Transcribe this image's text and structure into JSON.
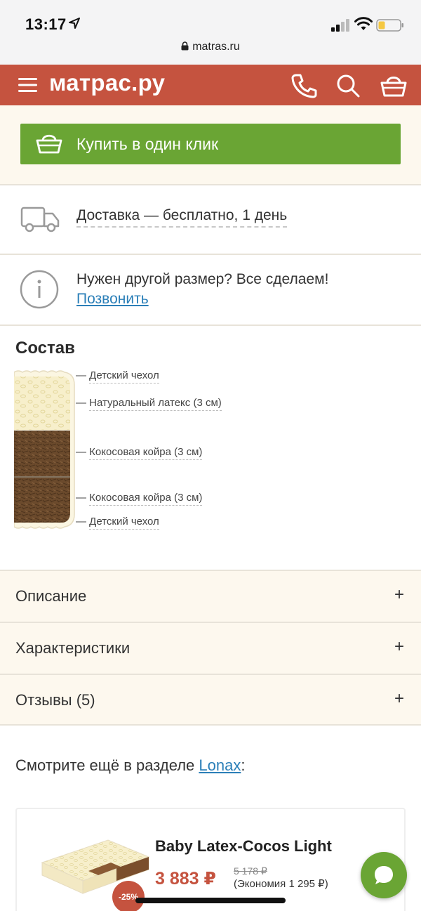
{
  "status_bar": {
    "time": "13:17"
  },
  "url_bar": {
    "url": "matras.ru"
  },
  "header": {
    "logo": "матрас.ру"
  },
  "buy": {
    "label": "Купить в один клик"
  },
  "delivery": {
    "text": "Доставка — бесплатно, 1 день"
  },
  "custom_size": {
    "text": "Нужен другой размер? Все сделаем!",
    "link": "Позвонить"
  },
  "composition": {
    "title": "Состав",
    "layers": [
      {
        "label": "Детский чехол"
      },
      {
        "label": "Натуральный латекс (3 см)"
      },
      {
        "label": "Кокосовая койра (3 см)"
      },
      {
        "label": "Кокосовая койра (3 см)"
      },
      {
        "label": "Детский чехол"
      }
    ]
  },
  "accordion": [
    {
      "label": "Описание",
      "icon": "+"
    },
    {
      "label": "Характеристики",
      "icon": "+"
    },
    {
      "label": "Отзывы (5)",
      "icon": "+"
    }
  ],
  "see_also": {
    "prefix": "Смотрите ещё в разделе ",
    "link": "Lonax",
    "suffix": ":"
  },
  "product": {
    "title": "Baby Latex-Cocos Light",
    "price": "3 883 ₽",
    "old_price": "5 178 ₽",
    "saving": "(Экономия 1 295 ₽)",
    "discount": "-25%"
  },
  "colors": {
    "brand_red": "#c5533f",
    "green": "#6aa534",
    "link_blue": "#2b7fb8",
    "cream": "#fdf8ee"
  }
}
